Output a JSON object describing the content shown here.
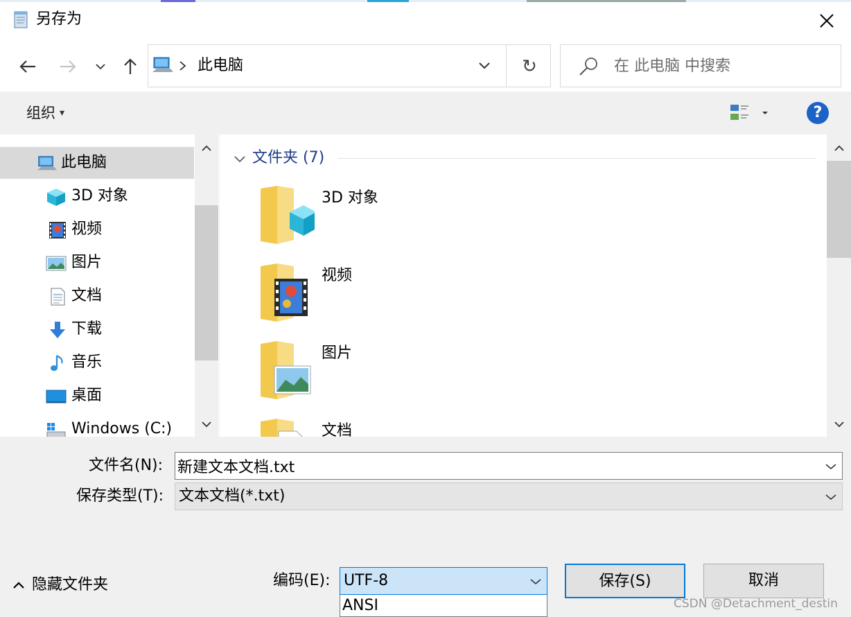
{
  "window": {
    "title": "另存为",
    "close_glyph": "✕"
  },
  "address": {
    "back_glyph": "←",
    "forward_glyph": "→",
    "recent_glyph": "⌄",
    "up_glyph": "↑",
    "path": "此电脑",
    "refresh_glyph": "↻"
  },
  "search": {
    "placeholder": "在 此电脑 中搜索"
  },
  "toolbar": {
    "organize_label": "组织",
    "organize_caret": "▾",
    "help_glyph": "?"
  },
  "nav": {
    "items": [
      {
        "label": "此电脑",
        "icon": "computer-icon",
        "selected": true
      },
      {
        "label": "3D 对象",
        "icon": "3d-objects-icon"
      },
      {
        "label": "视频",
        "icon": "video-icon"
      },
      {
        "label": "图片",
        "icon": "pictures-icon"
      },
      {
        "label": "文档",
        "icon": "documents-icon"
      },
      {
        "label": "下载",
        "icon": "download-icon"
      },
      {
        "label": "音乐",
        "icon": "music-icon"
      },
      {
        "label": "桌面",
        "icon": "desktop-icon"
      },
      {
        "label": "Windows (C:)",
        "icon": "drive-icon"
      }
    ]
  },
  "content": {
    "group_label": "文件夹 (7)",
    "items": [
      {
        "label": "3D 对象",
        "icon": "folder-3d-icon"
      },
      {
        "label": "视频",
        "icon": "folder-video-icon"
      },
      {
        "label": "图片",
        "icon": "folder-pictures-icon"
      },
      {
        "label": "文档",
        "icon": "folder-documents-icon"
      }
    ]
  },
  "form": {
    "filename_label": "文件名(N):",
    "filename_value": "新建文本文档.txt",
    "type_label": "保存类型(T):",
    "type_value": "文本文档(*.txt)",
    "hide_folders_label": "隐藏文件夹",
    "encoding_label": "编码(E):",
    "encoding_value": "UTF-8",
    "encoding_option": "ANSI",
    "save_label": "保存(S)",
    "cancel_label": "取消"
  },
  "watermark": "CSDN @Detachment_destin",
  "colors": {
    "accent": "#0078d7",
    "selected_bg": "#d9d9d9",
    "toolbar_bg": "#f0f0f0",
    "help": "#1d62c8",
    "group_text": "#1e3a8a"
  }
}
